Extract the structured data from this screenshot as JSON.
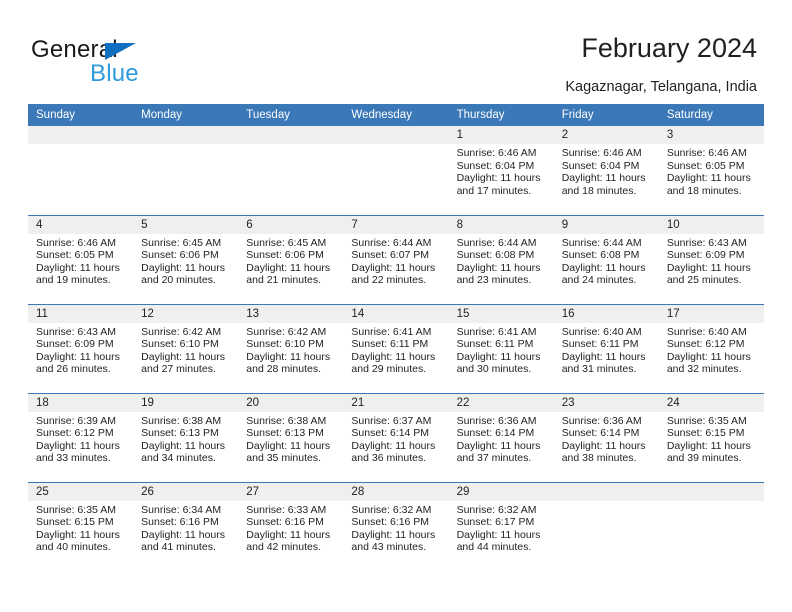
{
  "brand": {
    "name_top": "General",
    "name_bottom": "Blue",
    "triangle_color": "#0f6fc0",
    "blue_text_color": "#2e9bdc"
  },
  "header": {
    "title": "February 2024",
    "location": "Kagaznagar, Telangana, India",
    "header_bg_color": "#3b78b8",
    "daynum_bg_color": "#efefef"
  },
  "weekdays": [
    "Sunday",
    "Monday",
    "Tuesday",
    "Wednesday",
    "Thursday",
    "Friday",
    "Saturday"
  ],
  "weeks": [
    [
      {
        "day": "",
        "empty": true
      },
      {
        "day": "",
        "empty": true
      },
      {
        "day": "",
        "empty": true
      },
      {
        "day": "",
        "empty": true
      },
      {
        "day": "1",
        "sunrise": "Sunrise: 6:46 AM",
        "sunset": "Sunset: 6:04 PM",
        "daylight1": "Daylight: 11 hours",
        "daylight2": "and 17 minutes."
      },
      {
        "day": "2",
        "sunrise": "Sunrise: 6:46 AM",
        "sunset": "Sunset: 6:04 PM",
        "daylight1": "Daylight: 11 hours",
        "daylight2": "and 18 minutes."
      },
      {
        "day": "3",
        "sunrise": "Sunrise: 6:46 AM",
        "sunset": "Sunset: 6:05 PM",
        "daylight1": "Daylight: 11 hours",
        "daylight2": "and 18 minutes."
      }
    ],
    [
      {
        "day": "4",
        "sunrise": "Sunrise: 6:46 AM",
        "sunset": "Sunset: 6:05 PM",
        "daylight1": "Daylight: 11 hours",
        "daylight2": "and 19 minutes."
      },
      {
        "day": "5",
        "sunrise": "Sunrise: 6:45 AM",
        "sunset": "Sunset: 6:06 PM",
        "daylight1": "Daylight: 11 hours",
        "daylight2": "and 20 minutes."
      },
      {
        "day": "6",
        "sunrise": "Sunrise: 6:45 AM",
        "sunset": "Sunset: 6:06 PM",
        "daylight1": "Daylight: 11 hours",
        "daylight2": "and 21 minutes."
      },
      {
        "day": "7",
        "sunrise": "Sunrise: 6:44 AM",
        "sunset": "Sunset: 6:07 PM",
        "daylight1": "Daylight: 11 hours",
        "daylight2": "and 22 minutes."
      },
      {
        "day": "8",
        "sunrise": "Sunrise: 6:44 AM",
        "sunset": "Sunset: 6:08 PM",
        "daylight1": "Daylight: 11 hours",
        "daylight2": "and 23 minutes."
      },
      {
        "day": "9",
        "sunrise": "Sunrise: 6:44 AM",
        "sunset": "Sunset: 6:08 PM",
        "daylight1": "Daylight: 11 hours",
        "daylight2": "and 24 minutes."
      },
      {
        "day": "10",
        "sunrise": "Sunrise: 6:43 AM",
        "sunset": "Sunset: 6:09 PM",
        "daylight1": "Daylight: 11 hours",
        "daylight2": "and 25 minutes."
      }
    ],
    [
      {
        "day": "11",
        "sunrise": "Sunrise: 6:43 AM",
        "sunset": "Sunset: 6:09 PM",
        "daylight1": "Daylight: 11 hours",
        "daylight2": "and 26 minutes."
      },
      {
        "day": "12",
        "sunrise": "Sunrise: 6:42 AM",
        "sunset": "Sunset: 6:10 PM",
        "daylight1": "Daylight: 11 hours",
        "daylight2": "and 27 minutes."
      },
      {
        "day": "13",
        "sunrise": "Sunrise: 6:42 AM",
        "sunset": "Sunset: 6:10 PM",
        "daylight1": "Daylight: 11 hours",
        "daylight2": "and 28 minutes."
      },
      {
        "day": "14",
        "sunrise": "Sunrise: 6:41 AM",
        "sunset": "Sunset: 6:11 PM",
        "daylight1": "Daylight: 11 hours",
        "daylight2": "and 29 minutes."
      },
      {
        "day": "15",
        "sunrise": "Sunrise: 6:41 AM",
        "sunset": "Sunset: 6:11 PM",
        "daylight1": "Daylight: 11 hours",
        "daylight2": "and 30 minutes."
      },
      {
        "day": "16",
        "sunrise": "Sunrise: 6:40 AM",
        "sunset": "Sunset: 6:11 PM",
        "daylight1": "Daylight: 11 hours",
        "daylight2": "and 31 minutes."
      },
      {
        "day": "17",
        "sunrise": "Sunrise: 6:40 AM",
        "sunset": "Sunset: 6:12 PM",
        "daylight1": "Daylight: 11 hours",
        "daylight2": "and 32 minutes."
      }
    ],
    [
      {
        "day": "18",
        "sunrise": "Sunrise: 6:39 AM",
        "sunset": "Sunset: 6:12 PM",
        "daylight1": "Daylight: 11 hours",
        "daylight2": "and 33 minutes."
      },
      {
        "day": "19",
        "sunrise": "Sunrise: 6:38 AM",
        "sunset": "Sunset: 6:13 PM",
        "daylight1": "Daylight: 11 hours",
        "daylight2": "and 34 minutes."
      },
      {
        "day": "20",
        "sunrise": "Sunrise: 6:38 AM",
        "sunset": "Sunset: 6:13 PM",
        "daylight1": "Daylight: 11 hours",
        "daylight2": "and 35 minutes."
      },
      {
        "day": "21",
        "sunrise": "Sunrise: 6:37 AM",
        "sunset": "Sunset: 6:14 PM",
        "daylight1": "Daylight: 11 hours",
        "daylight2": "and 36 minutes."
      },
      {
        "day": "22",
        "sunrise": "Sunrise: 6:36 AM",
        "sunset": "Sunset: 6:14 PM",
        "daylight1": "Daylight: 11 hours",
        "daylight2": "and 37 minutes."
      },
      {
        "day": "23",
        "sunrise": "Sunrise: 6:36 AM",
        "sunset": "Sunset: 6:14 PM",
        "daylight1": "Daylight: 11 hours",
        "daylight2": "and 38 minutes."
      },
      {
        "day": "24",
        "sunrise": "Sunrise: 6:35 AM",
        "sunset": "Sunset: 6:15 PM",
        "daylight1": "Daylight: 11 hours",
        "daylight2": "and 39 minutes."
      }
    ],
    [
      {
        "day": "25",
        "sunrise": "Sunrise: 6:35 AM",
        "sunset": "Sunset: 6:15 PM",
        "daylight1": "Daylight: 11 hours",
        "daylight2": "and 40 minutes."
      },
      {
        "day": "26",
        "sunrise": "Sunrise: 6:34 AM",
        "sunset": "Sunset: 6:16 PM",
        "daylight1": "Daylight: 11 hours",
        "daylight2": "and 41 minutes."
      },
      {
        "day": "27",
        "sunrise": "Sunrise: 6:33 AM",
        "sunset": "Sunset: 6:16 PM",
        "daylight1": "Daylight: 11 hours",
        "daylight2": "and 42 minutes."
      },
      {
        "day": "28",
        "sunrise": "Sunrise: 6:32 AM",
        "sunset": "Sunset: 6:16 PM",
        "daylight1": "Daylight: 11 hours",
        "daylight2": "and 43 minutes."
      },
      {
        "day": "29",
        "sunrise": "Sunrise: 6:32 AM",
        "sunset": "Sunset: 6:17 PM",
        "daylight1": "Daylight: 11 hours",
        "daylight2": "and 44 minutes."
      },
      {
        "day": "",
        "empty": true
      },
      {
        "day": "",
        "empty": true
      }
    ]
  ]
}
